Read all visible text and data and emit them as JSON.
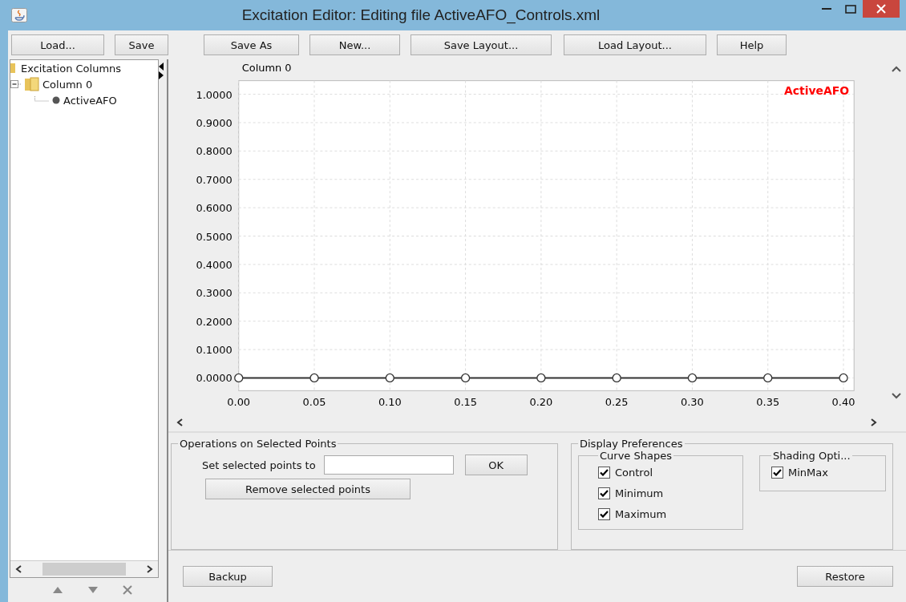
{
  "window": {
    "title": "Excitation Editor: Editing file ActiveAFO_Controls.xml"
  },
  "toolbar": [
    "Load...",
    "Save",
    "Save As",
    "New...",
    "Save Layout...",
    "Load Layout...",
    "Help"
  ],
  "tree": {
    "label": "Excitation Columns",
    "children": [
      {
        "label": "Column 0",
        "expanded": true,
        "children": [
          {
            "label": "ActiveAFO"
          }
        ]
      }
    ]
  },
  "chart": {
    "chart_data": {
      "type": "line",
      "title": "Column 0",
      "x": [
        0,
        0.05,
        0.1,
        0.15,
        0.2,
        0.25,
        0.3,
        0.35,
        0.4
      ],
      "grid": true,
      "series": [
        {
          "name": "ActiveAFO",
          "color": "#333333",
          "marker": "circle",
          "values": [
            0,
            0,
            0,
            0,
            0,
            0,
            0,
            0,
            0
          ]
        }
      ],
      "xlim": [
        0,
        0.407
      ],
      "ylim": [
        -0.045,
        1.048
      ],
      "xticks": [
        {
          "value": 0,
          "label": "0.00"
        },
        {
          "value": 0.05,
          "label": "0.05"
        },
        {
          "value": 0.1,
          "label": "0.10"
        },
        {
          "value": 0.15,
          "label": "0.15"
        },
        {
          "value": 0.2,
          "label": "0.20"
        },
        {
          "value": 0.25,
          "label": "0.25"
        },
        {
          "value": 0.3,
          "label": "0.30"
        },
        {
          "value": 0.35,
          "label": "0.35"
        },
        {
          "value": 0.4,
          "label": "0.40"
        }
      ],
      "yticks": [
        {
          "value": 0,
          "label": "0.0000"
        },
        {
          "value": 0.1,
          "label": "0.1000"
        },
        {
          "value": 0.2,
          "label": "0.2000"
        },
        {
          "value": 0.3,
          "label": "0.3000"
        },
        {
          "value": 0.4,
          "label": "0.4000"
        },
        {
          "value": 0.5,
          "label": "0.5000"
        },
        {
          "value": 0.6,
          "label": "0.6000"
        },
        {
          "value": 0.7,
          "label": "0.7000"
        },
        {
          "value": 0.8,
          "label": "0.8000"
        },
        {
          "value": 0.9,
          "label": "0.9000"
        },
        {
          "value": 1,
          "label": "1.0000"
        }
      ]
    },
    "legend": {
      "color": "#ff0000"
    }
  },
  "operations": {
    "title": "Operations on Selected Points",
    "set_label": "Set selected points to",
    "ok": "OK",
    "remove": "Remove selected points"
  },
  "display": {
    "title": "Display Preferences",
    "curve_shapes": {
      "title": "Curve Shapes",
      "options": [
        {
          "label": "Control",
          "checked": true
        },
        {
          "label": "Minimum",
          "checked": true
        },
        {
          "label": "Maximum",
          "checked": true
        }
      ]
    },
    "shading": {
      "title": "Shading Opti...",
      "options": [
        {
          "label": "MinMax",
          "checked": true
        }
      ]
    }
  },
  "footer": {
    "backup": "Backup",
    "restore": "Restore"
  }
}
